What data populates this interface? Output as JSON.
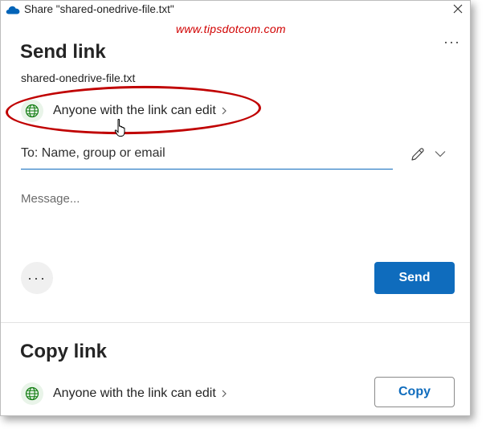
{
  "window": {
    "title": "Share \"shared-onedrive-file.txt\""
  },
  "watermark": "www.tipsdotcom.com",
  "send_section": {
    "heading": "Send link",
    "filename": "shared-onedrive-file.txt",
    "permission": "Anyone with the link can edit",
    "to_placeholder": "To: Name, group or email",
    "message_placeholder": "Message...",
    "more_label": "···",
    "send_label": "Send"
  },
  "copy_section": {
    "heading": "Copy link",
    "permission": "Anyone with the link can edit",
    "copy_label": "Copy"
  },
  "top_more": "···",
  "colors": {
    "accent": "#0f6cbd",
    "globe": "#107c10",
    "highlight": "#c00000",
    "watermark": "#d10000"
  },
  "icons": [
    "onedrive-cloud-icon",
    "close-icon",
    "globe-icon",
    "chevron-right-icon",
    "pencil-icon",
    "chevron-down-icon",
    "hand-cursor-icon"
  ]
}
